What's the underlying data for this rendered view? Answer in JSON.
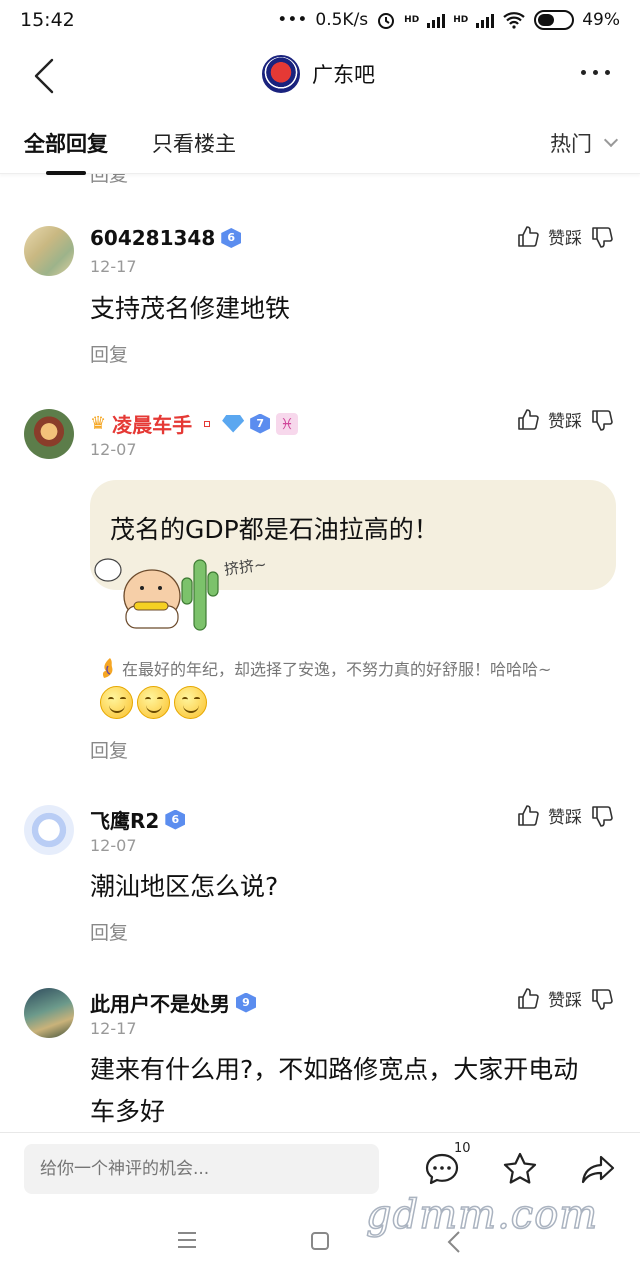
{
  "status_bar": {
    "time": "15:42",
    "network_speed": "0.5K/s",
    "hd1": "HD",
    "hd2": "HD",
    "battery": "49%",
    "battery_level": 0.49
  },
  "nav": {
    "forum_name": "广东吧"
  },
  "tabs": {
    "all_replies": "全部回复",
    "op_only": "只看楼主",
    "sort": "热门"
  },
  "feed": {
    "cutoff_reply": "回复",
    "posts": [
      {
        "username": "604281348",
        "level": "6",
        "date": "12-17",
        "vote_label": "赞踩",
        "content": "支持茂名修建地铁",
        "reply": "回复"
      },
      {
        "username": "凌晨车手",
        "level": "7",
        "date": "12-07",
        "vote_label": "赞踩",
        "content": "茂名的GDP都是石油拉高的！",
        "sticker_text": "挤挤~",
        "signature": "在最好的年纪，却选择了安逸，不努力真的好舒服！哈哈哈~",
        "reply": "回复"
      },
      {
        "username": "飞鹰R2",
        "level": "6",
        "date": "12-07",
        "vote_label": "赞踩",
        "content": "潮汕地区怎么说?",
        "reply": "回复"
      },
      {
        "username": "此用户不是处男",
        "level": "9",
        "date": "12-17",
        "vote_label": "赞踩",
        "content": "建来有什么用?，不如路修宽点，大家开电动车多好"
      }
    ]
  },
  "bottom": {
    "placeholder": "给你一个神评的机会...",
    "comment_count": "10"
  },
  "watermark": "gdmm.com"
}
